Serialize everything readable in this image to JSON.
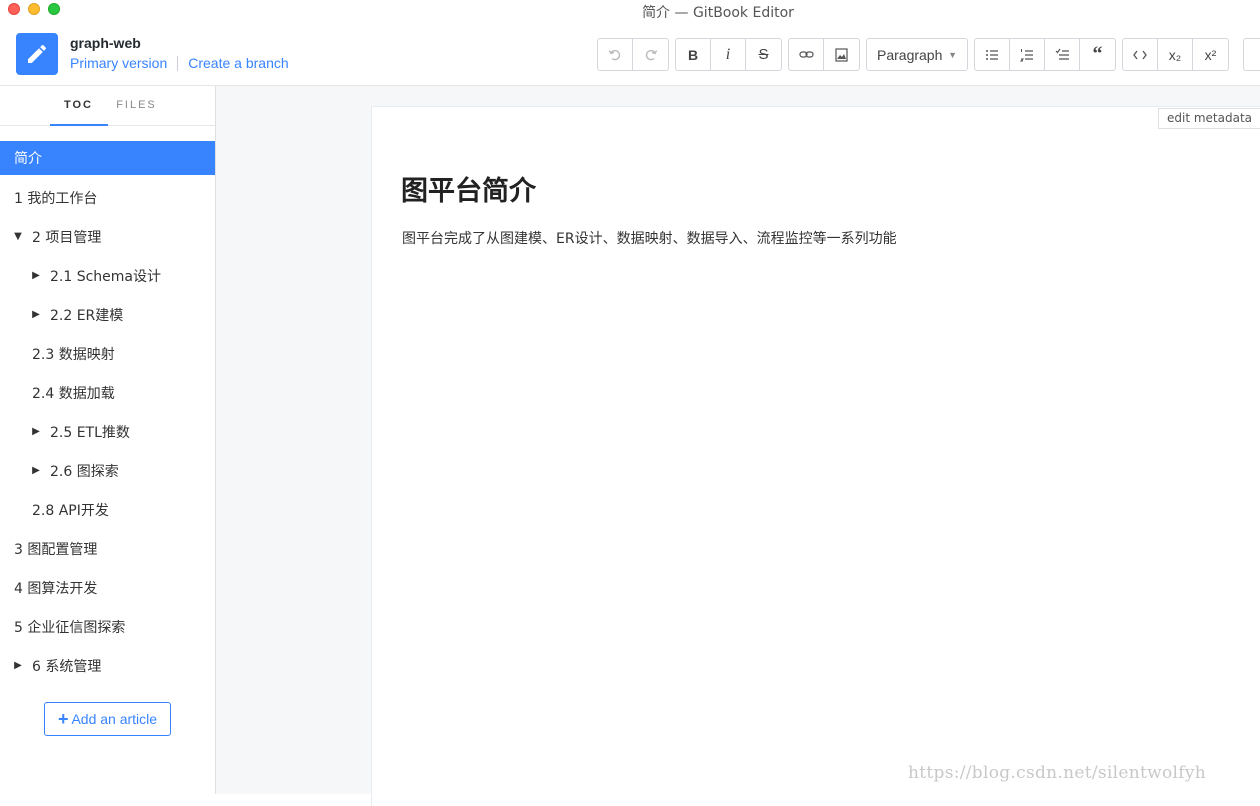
{
  "window": {
    "title": "简介 — GitBook Editor"
  },
  "header": {
    "book_name": "graph-web",
    "version_link": "Primary version",
    "branch_link": "Create a branch"
  },
  "toolbar": {
    "paragraph_label": "Paragraph",
    "bold": "B",
    "italic": "i",
    "strike": "S",
    "sub": "x₂",
    "sup": "x²"
  },
  "sidebar": {
    "tabs": [
      "TOC",
      "FILES"
    ],
    "items": [
      {
        "label": "简介"
      },
      {
        "label": "1 我的工作台"
      },
      {
        "label": "2 项目管理"
      },
      {
        "label": "2.1 Schema设计"
      },
      {
        "label": "2.2 ER建模"
      },
      {
        "label": "2.3 数据映射"
      },
      {
        "label": "2.4 数据加载"
      },
      {
        "label": "2.5 ETL推数"
      },
      {
        "label": "2.6 图探索"
      },
      {
        "label": "2.8 API开发"
      },
      {
        "label": "3 图配置管理"
      },
      {
        "label": "4 图算法开发"
      },
      {
        "label": "5 企业征信图探索"
      },
      {
        "label": "6 系统管理"
      }
    ],
    "add_article": "Add an article"
  },
  "editor": {
    "metadata_button": "edit metadata",
    "heading": "图平台简介",
    "paragraph": "图平台完成了从图建模、ER设计、数据映射、数据导入、流程监控等一系列功能"
  },
  "watermark": "https://blog.csdn.net/silentwolfyh",
  "colors": {
    "accent": "#3884ff"
  }
}
